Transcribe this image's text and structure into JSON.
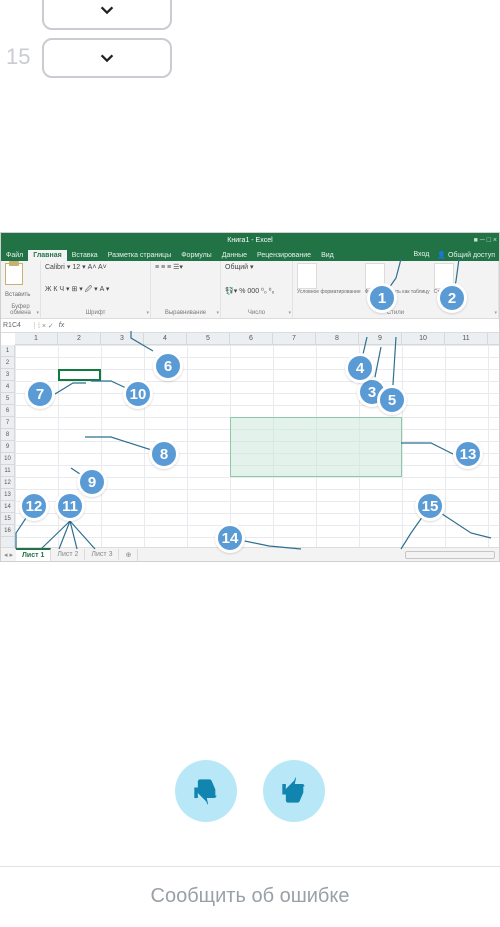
{
  "dropdowns": {
    "fifteen_label": "15"
  },
  "excel": {
    "title": "Книга1 - Excel",
    "title_right": "■  ─  □  ×",
    "tabs": {
      "file": "Файл",
      "home": "Главная",
      "insert": "Вставка",
      "layout": "Разметка страницы",
      "formulas": "Формулы",
      "data": "Данные",
      "review": "Рецензирование",
      "view": "Вид",
      "signin": "Вход",
      "share": "Общий доступ"
    },
    "ribbon": {
      "clipboard": "Буфер обмена",
      "paste": "Вставить",
      "font_name": "Calibri",
      "font_size": "12",
      "font_ctrls": "Ж К Ч ▾ ⊞ ▾ 🖉 ▾ A ▾",
      "font_size_ctrls": "A˄ A˅",
      "font": "Шрифт",
      "align": "Выравнивание",
      "align_ctrls": "≡ ≡ ≡  ☰▾",
      "number": "Число",
      "number_fmt": "Общий",
      "number_ctrls": "% 000 ⁰₀ ⁰₀",
      "cond_fmt": "Условное форматирование",
      "as_table": "Форматировать как таблицу",
      "cell_styles": "Стили ячеек",
      "styles": "Стили"
    },
    "formula_bar": {
      "name_box": "R1C4",
      "ctrls": "⁞ × ✓",
      "fx": "fx"
    },
    "columns": [
      "1",
      "2",
      "3",
      "4",
      "5",
      "6",
      "7",
      "8",
      "9",
      "10",
      "11"
    ],
    "rows": [
      "1",
      "2",
      "3",
      "4",
      "5",
      "6",
      "7",
      "8",
      "9",
      "10",
      "11",
      "12",
      "13",
      "14",
      "15",
      "16"
    ],
    "sheets": {
      "nav": "◂ ▸",
      "s1": "Лист 1",
      "s2": "Лист 2",
      "s3": "Лист 3",
      "add": "⊕"
    }
  },
  "badges": {
    "n1": "1",
    "n2": "2",
    "n3": "3",
    "n4": "4",
    "n5": "5",
    "n6": "6",
    "n7": "7",
    "n8": "8",
    "n9": "9",
    "n10": "10",
    "n11": "11",
    "n12": "12",
    "n13": "13",
    "n14": "14",
    "n15": "15"
  },
  "footer": {
    "report_error": "Сообщить об ошибке"
  }
}
